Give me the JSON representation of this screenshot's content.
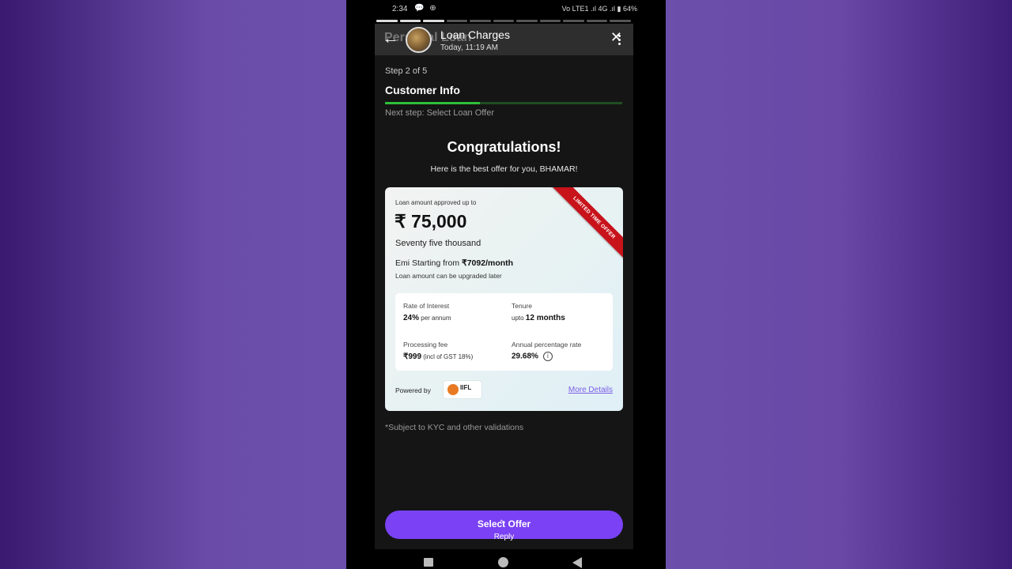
{
  "status_bar": {
    "time": "2:34",
    "left_icons": "💬 ⊕",
    "right_text": "Vo LTE1 .ıl 4G .ıl ▮ 64%",
    "battery": "64%"
  },
  "story_bar": {
    "segments_total": 11,
    "segments_done": 3
  },
  "story_header": {
    "ghost_title": "Personal Loan",
    "title": "Loan Charges",
    "timestamp": "Today, 11:19 AM",
    "back_glyph": "←",
    "close_glyph": "✕"
  },
  "step": {
    "label": "Step 2 of 5",
    "title": "Customer Info",
    "progress_fraction": 0.4,
    "next": "Next step: Select Loan Offer"
  },
  "headline": "Congratulations!",
  "subheadline": "Here is the best offer for you, BHAMAR!",
  "offer_card": {
    "ribbon": "LIMITED TIME OFFER",
    "amount_label": "Loan amount approved up to",
    "amount": "₹ 75,000",
    "amount_words": "Seventy five thousand",
    "emi_prefix": "Emi Starting from ",
    "emi_value": "₹7092/month",
    "upgrade_note": "Loan amount can be upgraded later",
    "details": {
      "rate_label": "Rate of Interest",
      "rate_value": "24%",
      "rate_suffix": " per annum",
      "tenure_label": "Tenure",
      "tenure_prefix": "upto ",
      "tenure_value": "12 months",
      "fee_label": "Processing fee",
      "fee_value": "₹999",
      "fee_suffix": " (incl of GST 18%)",
      "apr_label": "Annual percentage rate",
      "apr_value": "29.68%",
      "info_glyph": "i"
    },
    "powered_by": "Powered by",
    "lender": "IIFL",
    "more_details": "More Details"
  },
  "kyc_note": "*Subject to KYC and other validations",
  "cta": {
    "label": "Select Offer",
    "reply": "Reply",
    "reply_chevron": "^"
  },
  "colors": {
    "accent": "#7a42f4",
    "progress": "#2fbf3a",
    "ribbon": "#c8131b",
    "link": "#7b5ce8"
  }
}
